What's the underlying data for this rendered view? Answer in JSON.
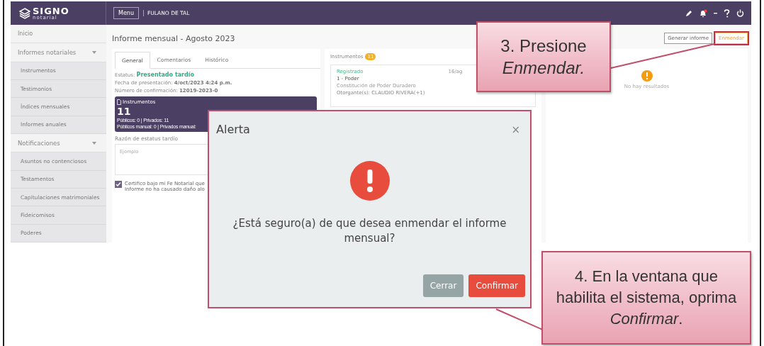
{
  "app": {
    "logo": {
      "name": "SIGNO",
      "tagline": "notarial"
    },
    "menu_button": "Menu",
    "user": "FULANO DE TAL"
  },
  "sidebar": {
    "items": [
      {
        "label": "Inicio"
      },
      {
        "label": "Informes notariales",
        "expanded": true,
        "children": [
          {
            "label": "Instrumentos"
          },
          {
            "label": "Testimonios"
          },
          {
            "label": "Índices mensuales"
          },
          {
            "label": "Informes anuales"
          }
        ]
      },
      {
        "label": "Notificaciones",
        "expanded": true,
        "children": [
          {
            "label": "Asuntos no contenciosos"
          },
          {
            "label": "Testamentos"
          },
          {
            "label": "Capitulaciones matrimoniales"
          },
          {
            "label": "Fideicomisos"
          },
          {
            "label": "Poderes"
          }
        ]
      }
    ]
  },
  "page": {
    "title": "Informe mensual - Agosto 2023",
    "actions": [
      {
        "label": "Generar informe",
        "kind": "default",
        "highlighted": false
      },
      {
        "label": "Enmendar",
        "kind": "warning",
        "highlighted": true
      }
    ]
  },
  "tabs": [
    {
      "label": "General",
      "selected": true
    },
    {
      "label": "Comentarios",
      "selected": false
    },
    {
      "label": "Histórico",
      "selected": false
    }
  ],
  "status": {
    "label": "Estatus:",
    "value": "Presentado tardío"
  },
  "fields": [
    {
      "label": "Fecha de presentación:",
      "value": "4/oct/2023 4:24 p.m."
    },
    {
      "label": "Número de confirmación:",
      "value": "12019-2023-0"
    }
  ],
  "summary_card": {
    "title": "Instrumentos",
    "count": "11",
    "lines": [
      "Públicos: 0 | Privados: 11",
      "Públicos manual: 0 | Privados manual:"
    ]
  },
  "late_reason": {
    "label": "Razón de estatus tardío",
    "placeholder": "Ejemplo"
  },
  "certification": {
    "checked": true,
    "lines": [
      "Certifico bajo mi Fe Notarial que",
      "Informe no ha causado daño alo"
    ]
  },
  "instruments": {
    "title": "Instrumentos",
    "count": "11",
    "items": [
      {
        "status": "Registrado",
        "title": "1 - Poder",
        "date": "16/ag",
        "subtitle": "Constitución de Poder Duradero",
        "parties": "Otorgante(s): CLAUDIO RIVERA(+1)"
      }
    ]
  },
  "results": {
    "message": "No hay resultados"
  },
  "dialog": {
    "title": "Alerta",
    "close": "×",
    "message": "¿Está seguro(a) de que desea enmendar el informe mensual?",
    "buttons": [
      {
        "label": "Cerrar",
        "kind": "secondary"
      },
      {
        "label": "Confirmar",
        "kind": "danger"
      }
    ]
  },
  "callouts": [
    {
      "text": "3. Presione *Enmendar.*"
    },
    {
      "text": "4. En la ventana que habilita el sistema, oprima *Confirmar*."
    }
  ]
}
